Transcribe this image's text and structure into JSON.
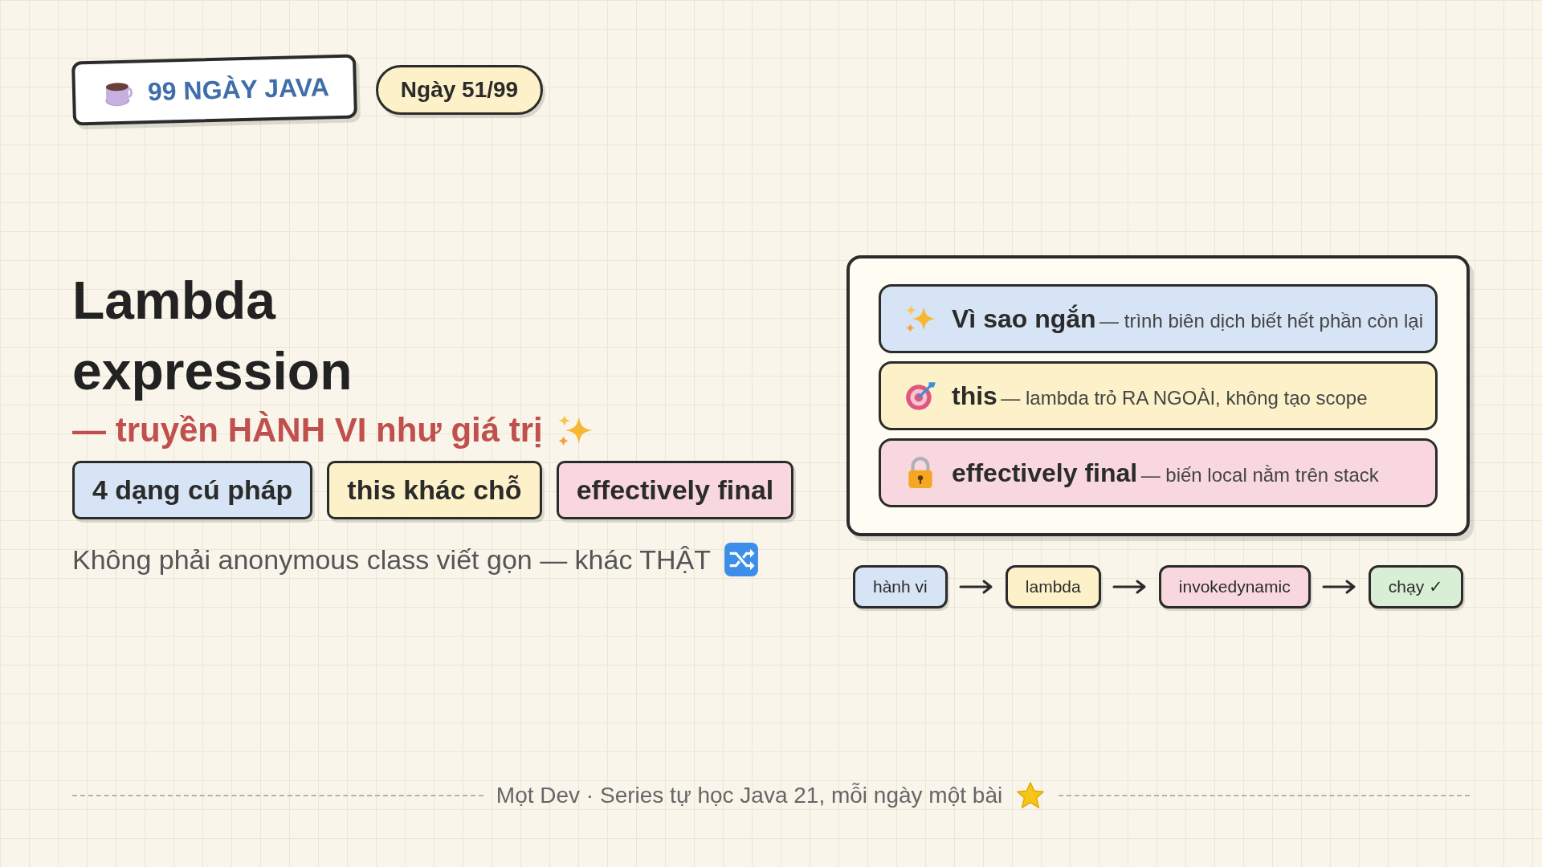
{
  "brand": {
    "title": "99 NGÀY JAVA"
  },
  "day_badge": "Ngày 51/99",
  "title_lines": [
    "Lambda",
    "expression"
  ],
  "subtitle": "— truyền HÀNH VI như giá trị",
  "tags": [
    {
      "label": "4 dạng cú pháp",
      "color": "#d6e4f5"
    },
    {
      "label": "this khác chỗ",
      "color": "#fcf1c8"
    },
    {
      "label": "effectively final",
      "color": "#f8d8de"
    }
  ],
  "description": "Không phải anonymous class viết gọn — khác THẬT",
  "points": [
    {
      "term": "Vì sao ngắn",
      "note": "— trình biên dịch biết hết phần còn lại",
      "color": "#d6e4f5"
    },
    {
      "term": "this",
      "note": "— lambda trỏ RA NGOÀI, không tạo scope",
      "color": "#fcf1c8"
    },
    {
      "term": "effectively final",
      "note": "— biến local nằm trên stack",
      "color": "#f8d8de"
    }
  ],
  "flow": [
    {
      "label": "hành vi",
      "color": "#d6e4f5"
    },
    {
      "label": "lambda",
      "color": "#fcf1c8"
    },
    {
      "label": "invokedynamic",
      "color": "#f8d8de"
    },
    {
      "label": "chạy ✓",
      "color": "#d9efd5"
    }
  ],
  "footer": "Mọt Dev · Series tự học Java 21, mỗi ngày một bài"
}
